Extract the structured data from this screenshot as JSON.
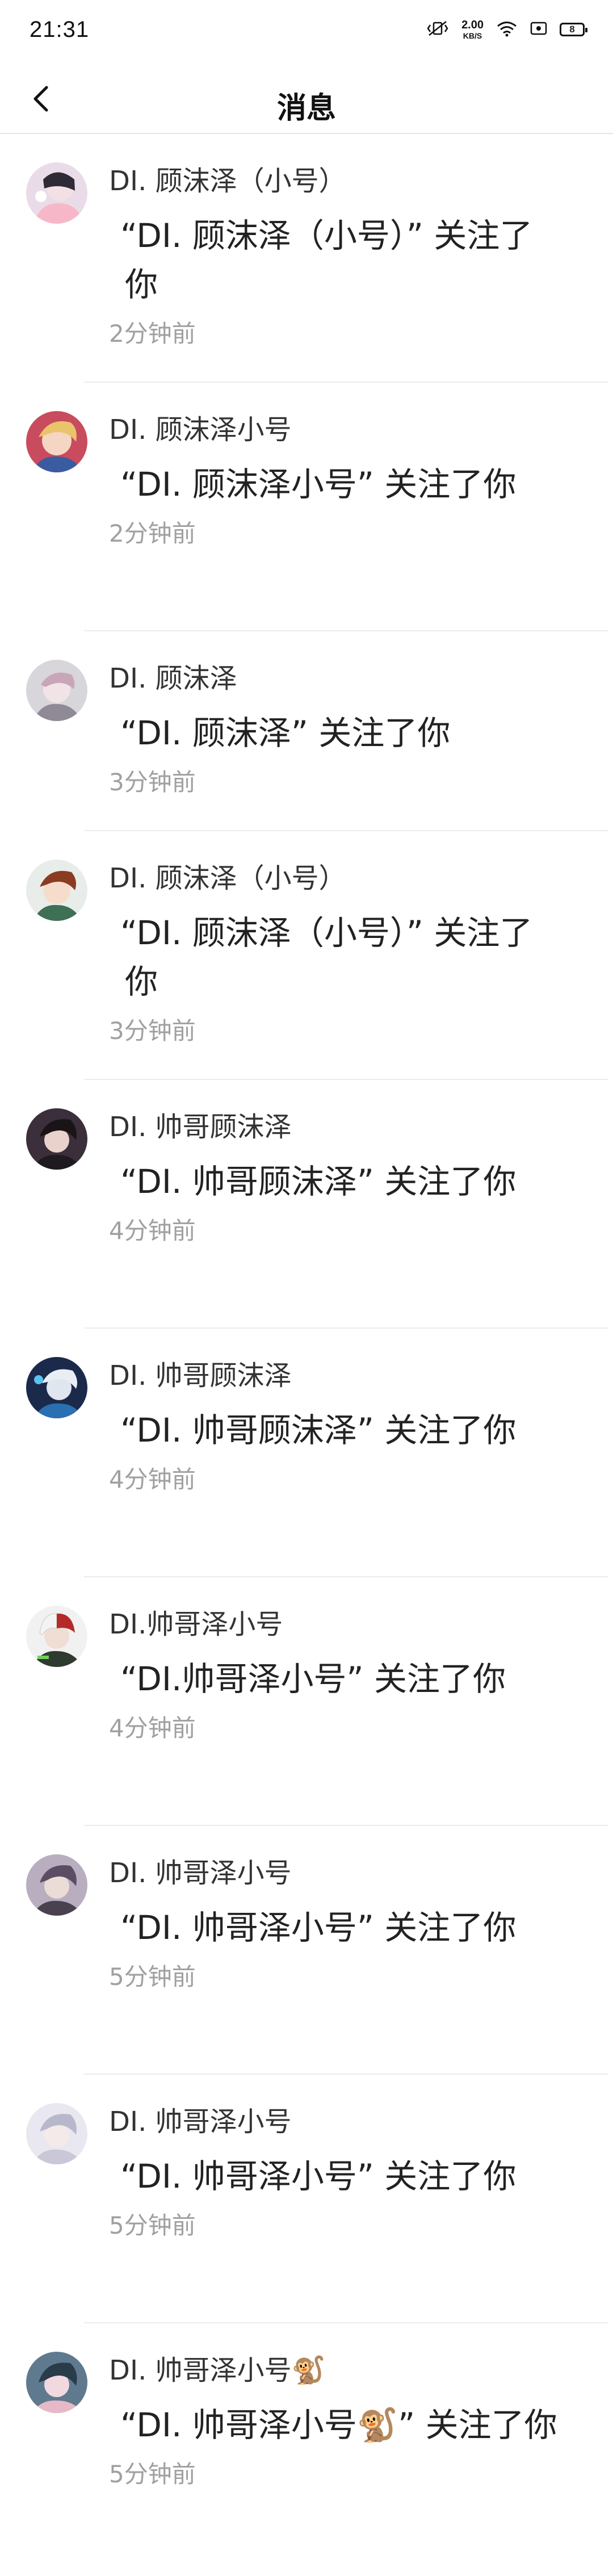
{
  "status_bar": {
    "time": "21:31",
    "net_speed_value": "2.00",
    "net_speed_unit": "KB/S",
    "battery": "8"
  },
  "header": {
    "title": "消息"
  },
  "colors": {
    "background": "#ffffff",
    "divider": "#ececec",
    "time_text": "#a0a0a0"
  },
  "messages": [
    {
      "name": "DI. 顾沫泽（小号）",
      "text": "“DI. 顾沫泽（小号）” 关注了你",
      "time": "2分钟前"
    },
    {
      "name": "DI. 顾沫泽小号",
      "text": "“DI. 顾沫泽小号” 关注了你",
      "time": "2分钟前"
    },
    {
      "name": "DI. 顾沫泽",
      "text": "“DI. 顾沫泽” 关注了你",
      "time": "3分钟前"
    },
    {
      "name": "DI. 顾沫泽（小号）",
      "text": "“DI. 顾沫泽（小号）” 关注了你",
      "time": "3分钟前"
    },
    {
      "name": "DI. 帅哥顾沫泽",
      "text": "“DI. 帅哥顾沫泽” 关注了你",
      "time": "4分钟前"
    },
    {
      "name": "DI. 帅哥顾沫泽",
      "text": "“DI. 帅哥顾沫泽” 关注了你",
      "time": "4分钟前"
    },
    {
      "name": "DI.帅哥泽小号",
      "text": "“DI.帅哥泽小号” 关注了你",
      "time": "4分钟前"
    },
    {
      "name": "DI. 帅哥泽小号",
      "text": "“DI. 帅哥泽小号” 关注了你",
      "time": "5分钟前"
    },
    {
      "name": "DI. 帅哥泽小号",
      "text": "“DI. 帅哥泽小号” 关注了你",
      "time": "5分钟前"
    },
    {
      "name": "DI. 帅哥泽小号🐒",
      "text": "“DI. 帅哥泽小号🐒” 关注了你",
      "time": "5分钟前"
    }
  ]
}
